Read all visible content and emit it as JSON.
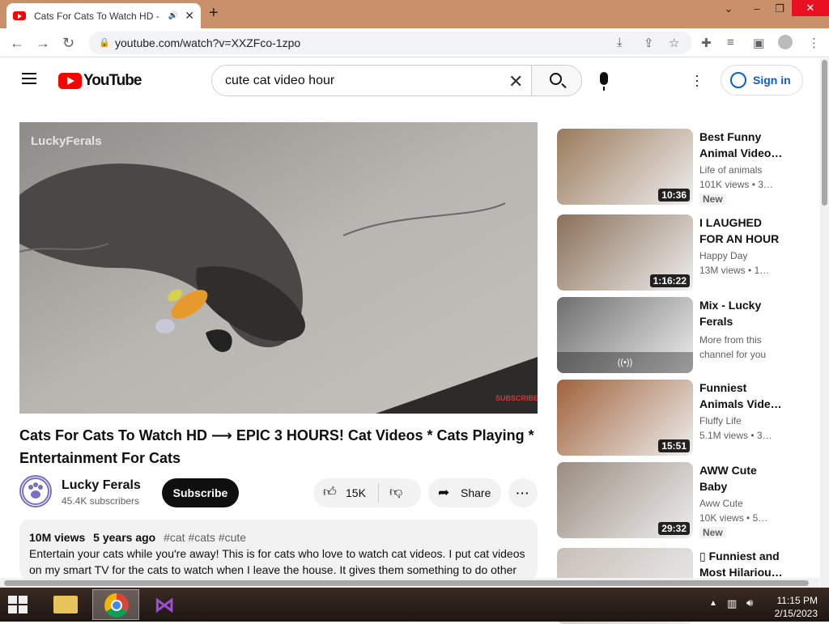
{
  "browser": {
    "tab_title": "Cats For Cats To Watch HD -",
    "url": "youtube.com/watch?v=XXZFco-1zpo"
  },
  "header": {
    "logo_text": "YouTube",
    "search_value": "cute cat video hour",
    "signin_label": "Sign in"
  },
  "video": {
    "watermark": "LuckyFerals",
    "subscribe_overlay": "SUBSCRIBE",
    "title": "Cats For Cats To Watch HD ⟶ EPIC 3 HOURS! Cat Videos * Cats Playing * Entertainment For Cats",
    "channel_name": "Lucky Ferals",
    "subscribers": "45.4K subscribers",
    "subscribe_label": "Subscribe",
    "likes": "15K",
    "share_label": "Share",
    "views": "10M views",
    "age": "5 years ago",
    "tags": "#cat #cats #cute",
    "description": "Entertain your cats while you're away! This is for cats who love to watch cat videos. I put cat videos on my smart TV for the cats to watch when I leave the house. It gives them something to do other"
  },
  "recommendations": [
    {
      "title": "Best Funny Animal Video…",
      "channel": "Life of animals",
      "views": "101K views",
      "age": "• 3…",
      "badge": "New",
      "duration": "10:36",
      "color": "#9a7a5a"
    },
    {
      "title": "I LAUGHED FOR AN HOUR😹…",
      "channel": "Happy Day",
      "views": "13M views",
      "age": "• 1…",
      "badge": "",
      "duration": "1:16:22",
      "color": "#8a7058"
    },
    {
      "title": "Mix - Lucky Ferals",
      "channel": "More from this channel for you",
      "views": "",
      "age": "",
      "badge": "",
      "duration": "",
      "color": "#6e6e6e"
    },
    {
      "title": "Funniest Animals Vide…",
      "channel": "Fluffy Life",
      "views": "5.1M views",
      "age": "• 3…",
      "badge": "",
      "duration": "15:51",
      "color": "#a0623a"
    },
    {
      "title": "AWW Cute Baby Animals…",
      "channel": "Aww Cute",
      "views": "10K views",
      "age": "• 5…",
      "badge": "New",
      "duration": "29:32",
      "color": "#9a8c80"
    },
    {
      "title": "▯ Funniest and Most Hilariou…",
      "channel": "",
      "views": "",
      "age": "",
      "badge": "",
      "duration": "",
      "color": "#c8bfb8"
    }
  ],
  "taskbar": {
    "time": "11:15 PM",
    "date": "2/15/2023"
  },
  "icons": [
    "youtube-favicon",
    "speaker-icon",
    "close-icon",
    "plus-icon",
    "back-icon",
    "forward-icon",
    "reload-icon",
    "lock-icon",
    "install-icon",
    "share-icon",
    "star-icon",
    "extensions-icon",
    "media-icon",
    "sidepanel-icon",
    "profile-icon",
    "menu-icon",
    "hamburger-icon",
    "clear-icon",
    "search-icon",
    "mic-icon",
    "kebab-icon",
    "account-icon",
    "like-icon",
    "dislike-icon",
    "share-arrow-icon",
    "windows-start-icon"
  ]
}
